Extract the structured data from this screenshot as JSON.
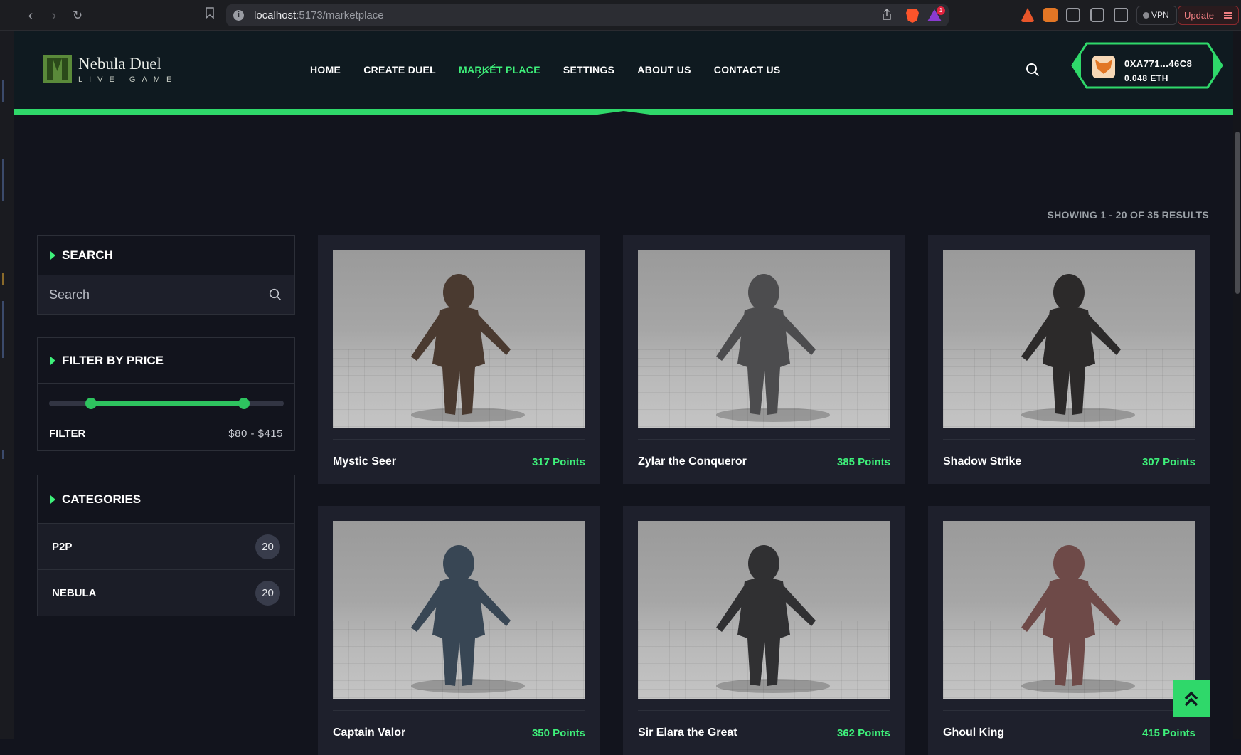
{
  "browser": {
    "url_host": "localhost",
    "url_path": ":5173/marketplace",
    "vpn_label": "VPN",
    "update_label": "Update",
    "notification_count": "1"
  },
  "header": {
    "logo_title": "Nebula Duel",
    "logo_subtitle": "LIVE GAME",
    "nav": [
      "HOME",
      "CREATE DUEL",
      "MARKET PLACE",
      "SETTINGS",
      "ABOUT US",
      "CONTACT US"
    ],
    "active_nav": "MARKET PLACE",
    "wallet_address": "0XA771...46C8",
    "wallet_balance": "0.048 ETH",
    "accent_color": "#3ef07a"
  },
  "results_text": "SHOWING 1 - 20 OF 35 RESULTS",
  "sidebar": {
    "search": {
      "title": "SEARCH",
      "placeholder": "Search"
    },
    "price": {
      "title": "FILTER BY PRICE",
      "filter_label": "FILTER",
      "range_text": "$80 - $415",
      "min": 80,
      "max": 415,
      "low_fraction": 0.18,
      "high_fraction": 0.83
    },
    "categories": {
      "title": "CATEGORIES",
      "items": [
        {
          "name": "P2P",
          "count": "20"
        },
        {
          "name": "NEBULA",
          "count": "20"
        }
      ]
    }
  },
  "products": [
    {
      "name": "Mystic Seer",
      "points": "317 Points",
      "figure_color": "#4a3a30"
    },
    {
      "name": "Zylar the Conqueror",
      "points": "385 Points",
      "figure_color": "#4c4c4e"
    },
    {
      "name": "Shadow Strike",
      "points": "307 Points",
      "figure_color": "#2c2a2a"
    },
    {
      "name": "Captain Valor",
      "points": "350 Points",
      "figure_color": "#384654"
    },
    {
      "name": "Sir Elara the Great",
      "points": "362 Points",
      "figure_color": "#303032"
    },
    {
      "name": "Ghoul King",
      "points": "415 Points",
      "figure_color": "#6e4a48"
    }
  ]
}
